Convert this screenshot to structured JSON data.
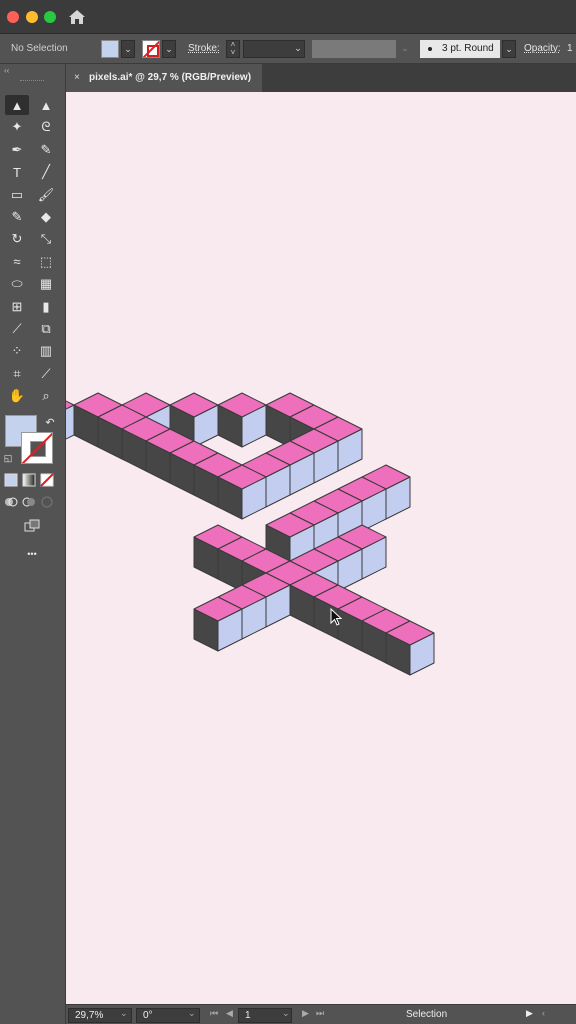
{
  "window": {
    "traffic_lights": [
      "close",
      "minimize",
      "maximize"
    ],
    "home_icon": "home-icon"
  },
  "control_bar": {
    "selection_label": "No Selection",
    "fill_color": "#c4d2ee",
    "stroke_label": "Stroke:",
    "brush_label": "3 pt. Round",
    "opacity_label": "Opacity:",
    "opacity_value": "1"
  },
  "document_tab": {
    "close_glyph": "×",
    "title": "pixels.ai* @ 29,7 % (RGB/Preview)"
  },
  "toolbar": {
    "tools": [
      {
        "name": "selection-tool-icon",
        "glyph": "▲"
      },
      {
        "name": "direct-selection-tool-icon",
        "glyph": "▲"
      },
      {
        "name": "magic-wand-tool-icon",
        "glyph": "✦"
      },
      {
        "name": "lasso-tool-icon",
        "glyph": "ᘓ"
      },
      {
        "name": "pen-tool-icon",
        "glyph": "✒"
      },
      {
        "name": "curvature-tool-icon",
        "glyph": "✎"
      },
      {
        "name": "type-tool-icon",
        "glyph": "T"
      },
      {
        "name": "line-tool-icon",
        "glyph": "╱"
      },
      {
        "name": "rectangle-tool-icon",
        "glyph": "▭"
      },
      {
        "name": "paintbrush-tool-icon",
        "glyph": "🖌"
      },
      {
        "name": "shaper-tool-icon",
        "glyph": "✎"
      },
      {
        "name": "eraser-tool-icon",
        "glyph": "◆"
      },
      {
        "name": "rotate-tool-icon",
        "glyph": "↻"
      },
      {
        "name": "scale-tool-icon",
        "glyph": "⤡"
      },
      {
        "name": "warp-tool-icon",
        "glyph": "≈"
      },
      {
        "name": "free-transform-tool-icon",
        "glyph": "⬚"
      },
      {
        "name": "shape-builder-tool-icon",
        "glyph": "⬭"
      },
      {
        "name": "perspective-grid-tool-icon",
        "glyph": "▦"
      },
      {
        "name": "mesh-tool-icon",
        "glyph": "⊞"
      },
      {
        "name": "gradient-tool-icon",
        "glyph": "▮"
      },
      {
        "name": "eyedropper-tool-icon",
        "glyph": "⟋"
      },
      {
        "name": "blend-tool-icon",
        "glyph": "⧉"
      },
      {
        "name": "symbol-sprayer-tool-icon",
        "glyph": "⁘"
      },
      {
        "name": "column-graph-tool-icon",
        "glyph": "▥"
      },
      {
        "name": "artboard-tool-icon",
        "glyph": "⌗"
      },
      {
        "name": "slice-tool-icon",
        "glyph": "⟋"
      },
      {
        "name": "hand-tool-icon",
        "glyph": "✋"
      },
      {
        "name": "zoom-tool-icon",
        "glyph": "⌕"
      }
    ],
    "more_glyph": "•••"
  },
  "artwork": {
    "top_color": "#ee6fbc",
    "left_color": "#464646",
    "right_color": "#c3cdf0",
    "outline_color": "#3a3a3a",
    "cells": [
      [
        0,
        5
      ],
      [
        1,
        4
      ],
      [
        2,
        3
      ],
      [
        2,
        4
      ],
      [
        3,
        2
      ],
      [
        3,
        4
      ],
      [
        4,
        1
      ],
      [
        4,
        4
      ],
      [
        5,
        0
      ],
      [
        5,
        4
      ],
      [
        6,
        0
      ],
      [
        6,
        4
      ],
      [
        7,
        0
      ],
      [
        7,
        1
      ],
      [
        7,
        2
      ],
      [
        7,
        3
      ],
      [
        7,
        4
      ],
      [
        10,
        1
      ],
      [
        10,
        2
      ],
      [
        10,
        3
      ],
      [
        10,
        4
      ],
      [
        10,
        5
      ],
      [
        9,
        7
      ],
      [
        10,
        7
      ],
      [
        11,
        7
      ],
      [
        12,
        7
      ],
      [
        13,
        7
      ],
      [
        14,
        7
      ],
      [
        15,
        7
      ],
      [
        16,
        7
      ],
      [
        17,
        7
      ],
      [
        12,
        4
      ],
      [
        12,
        5
      ],
      [
        12,
        6
      ],
      [
        12,
        8
      ],
      [
        12,
        9
      ],
      [
        12,
        10
      ]
    ]
  },
  "status_bar": {
    "zoom": "29,7%",
    "rotation": "0°",
    "artboard": "1",
    "current_tool": "Selection"
  }
}
